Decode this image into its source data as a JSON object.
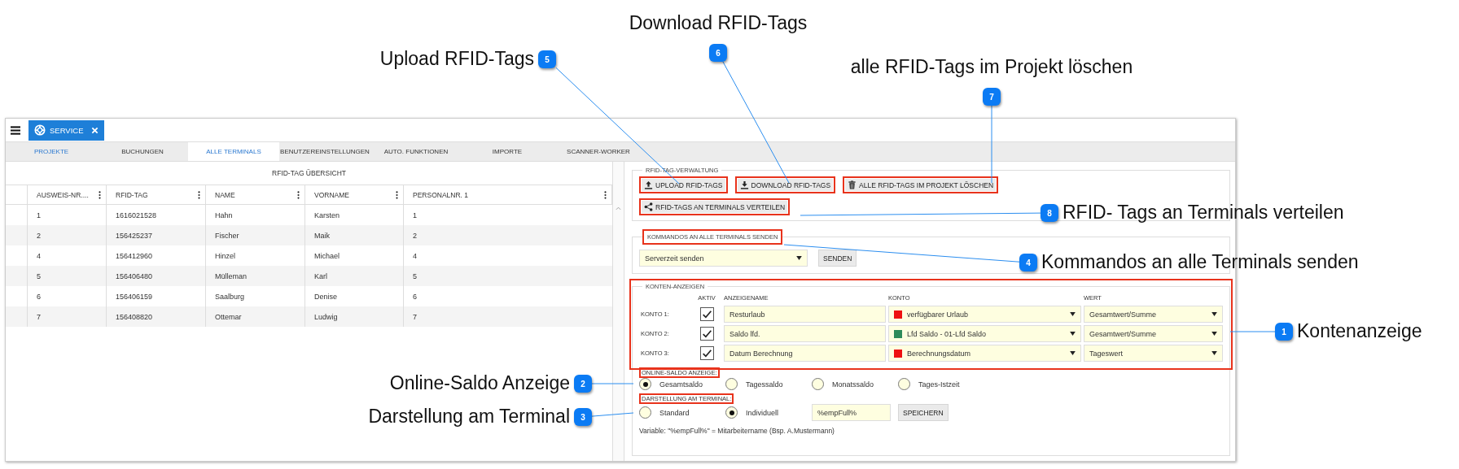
{
  "window_tab": {
    "label": "SERVICE"
  },
  "nav_tabs": [
    {
      "label": "PROJEKTE",
      "selected": false,
      "hovered": true
    },
    {
      "label": "BUCHUNGEN",
      "selected": false,
      "hovered": false
    },
    {
      "label": "ALLE TERMINALS",
      "selected": true,
      "hovered": false
    },
    {
      "label": "BENUTZEREINSTELLUNGEN",
      "selected": false,
      "hovered": false
    },
    {
      "label": "AUTO. FUNKTIONEN",
      "selected": false,
      "hovered": false
    },
    {
      "label": "IMPORTE",
      "selected": false,
      "hovered": false
    },
    {
      "label": "SCANNER-WORKER",
      "selected": false,
      "hovered": false
    }
  ],
  "rfid_table": {
    "title": "RFID-TAG ÜBERSICHT",
    "columns": [
      "AUSWEIS-NR....",
      "RFID-TAG",
      "NAME",
      "VORNAME",
      "PERSONALNR. 1"
    ],
    "rows": [
      [
        "1",
        "1616021528",
        "Hahn",
        "Karsten",
        "1"
      ],
      [
        "2",
        "156425237",
        "Fischer",
        "Maik",
        "2"
      ],
      [
        "4",
        "156412960",
        "Hinzel",
        "Michael",
        "4"
      ],
      [
        "5",
        "156406480",
        "Mülleman",
        "Karl",
        "5"
      ],
      [
        "6",
        "156406159",
        "Saalburg",
        "Denise",
        "6"
      ],
      [
        "7",
        "156408820",
        "Ottemar",
        "Ludwig",
        "7"
      ]
    ]
  },
  "rfid_management": {
    "legend": "RFID-TAG-VERWALTUNG",
    "buttons": [
      {
        "label": "UPLOAD RFID-TAGS",
        "kind": "upload",
        "highlighted": true
      },
      {
        "label": "DOWNLOAD RFID-TAGS",
        "kind": "download",
        "highlighted": true
      },
      {
        "label": "ALLE RFID-TAGS IM PROJEKT LÖSCHEN",
        "kind": "trash",
        "highlighted": true
      },
      {
        "label": "RFID-TAGS AN TERMINALS VERTEILEN",
        "kind": "share",
        "highlighted": true
      }
    ]
  },
  "commands": {
    "legend": "KOMMANDOS AN ALLE TERMINALS SENDEN",
    "highlighted": true,
    "select": {
      "value": "Serverzeit senden"
    },
    "button": "SENDEN"
  },
  "accounts": {
    "legend": "KONTEN-ANZEIGEN",
    "highlighted": true,
    "headers": [
      "AKTIV",
      "ANZEIGENAME",
      "KONTO",
      "WERT"
    ],
    "rows": [
      {
        "label": "KONTO 1:",
        "checked": true,
        "name": "Resturlaub",
        "konto": "verfügbarer Urlaub",
        "color": "#ee1111",
        "wert": "Gesamtwert/Summe"
      },
      {
        "label": "KONTO 2:",
        "checked": true,
        "name": "Saldo lfd.",
        "konto": "Lfd Saldo - 01-Lfd Saldo",
        "color": "#2e8b5a",
        "wert": "Gesamtwert/Summe"
      },
      {
        "label": "KONTO 3:",
        "checked": true,
        "name": "Datum Berechnung",
        "konto": "Berechnungsdatum",
        "color": "#ee1111",
        "wert": "Tageswert"
      }
    ],
    "online_saldo": {
      "label": "ONLINE-SALDO ANZEIGE:",
      "highlighted": true,
      "options": [
        {
          "label": "Gesamtsaldo",
          "selected": true
        },
        {
          "label": "Tagessaldo",
          "selected": false
        },
        {
          "label": "Monatssaldo",
          "selected": false
        },
        {
          "label": "Tages-Istzeit",
          "selected": false
        }
      ]
    },
    "display": {
      "label": "DARSTELLUNG AM TERMINAL:",
      "highlighted": true,
      "options": [
        {
          "label": "Standard",
          "selected": false
        },
        {
          "label": "Individuell",
          "selected": true
        }
      ],
      "value": "%empFull%",
      "button": "SPEICHERN"
    },
    "note": "Variable: \"%empFull%\" = Mitarbeitername (Bsp. A.Mustermann)"
  },
  "callouts": [
    {
      "number": "6",
      "text": "Download RFID-Tags"
    },
    {
      "number": "5",
      "text": "Upload RFID-Tags"
    },
    {
      "number": "7",
      "text": "alle RFID-Tags im Projekt löschen"
    },
    {
      "number": "8",
      "text": "RFID- Tags an Terminals verteilen"
    },
    {
      "number": "4",
      "text": "Kommandos an alle Terminals senden"
    },
    {
      "number": "1",
      "text": "Kontenanzeige"
    },
    {
      "number": "2",
      "text": "Online-Saldo Anzeige"
    },
    {
      "number": "3",
      "text": "Darstellung am Terminal"
    }
  ]
}
